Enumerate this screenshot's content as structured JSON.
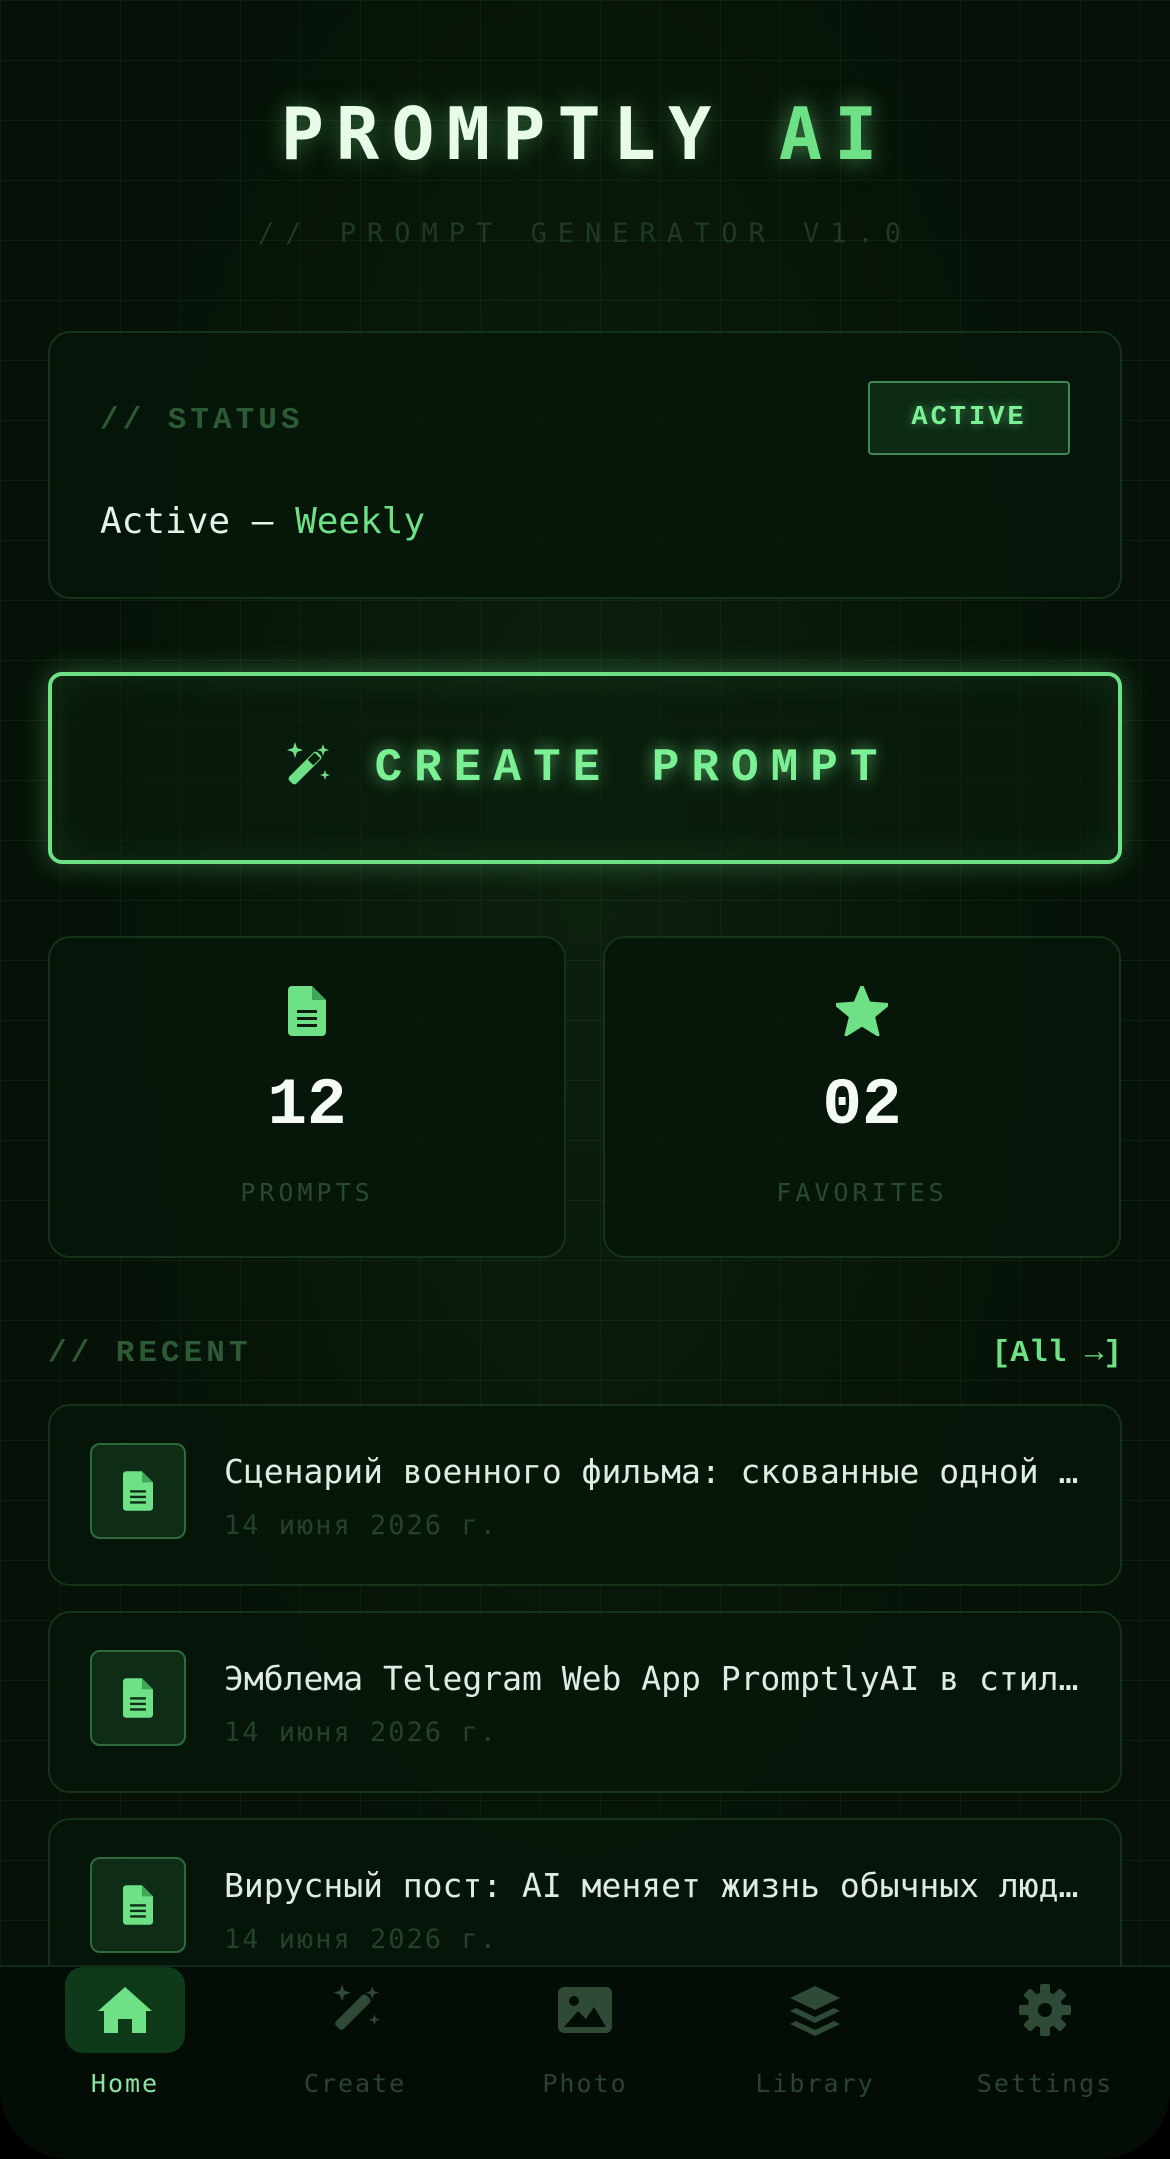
{
  "header": {
    "title_main": "PROMPTLY",
    "title_accent": "AI",
    "subtitle": "// PROMPT GENERATOR V1.0"
  },
  "status": {
    "label": "// STATUS",
    "badge": "ACTIVE",
    "state": "Active",
    "separator": " — ",
    "plan": "Weekly"
  },
  "create_button": {
    "label": "CREATE PROMPT",
    "icon": "magic-wand-icon"
  },
  "stats": [
    {
      "value": "12",
      "label": "PROMPTS",
      "icon": "document-icon"
    },
    {
      "value": "02",
      "label": "FAVORITES",
      "icon": "star-icon"
    }
  ],
  "recent": {
    "label": "// RECENT",
    "all_link": "[All →]",
    "items": [
      {
        "title": "Сценарий военного фильма: скованные одной цепью",
        "date": "14 июня 2026 г."
      },
      {
        "title": "Эмблема Telegram Web App PromptlyAI в стиле неон",
        "date": "14 июня 2026 г."
      },
      {
        "title": "Вирусный пост: AI меняет жизнь обычных людей",
        "date": "14 июня 2026 г."
      }
    ]
  },
  "nav": [
    {
      "label": "Home",
      "icon": "home-icon",
      "active": true
    },
    {
      "label": "Create",
      "icon": "magic-wand-icon",
      "active": false
    },
    {
      "label": "Photo",
      "icon": "image-icon",
      "active": false
    },
    {
      "label": "Library",
      "icon": "layers-icon",
      "active": false
    },
    {
      "label": "Settings",
      "icon": "gear-icon",
      "active": false
    }
  ],
  "colors": {
    "accent": "#6ee086",
    "background": "#061207",
    "text": "#e8f5ea",
    "muted": "#2c5a35"
  }
}
